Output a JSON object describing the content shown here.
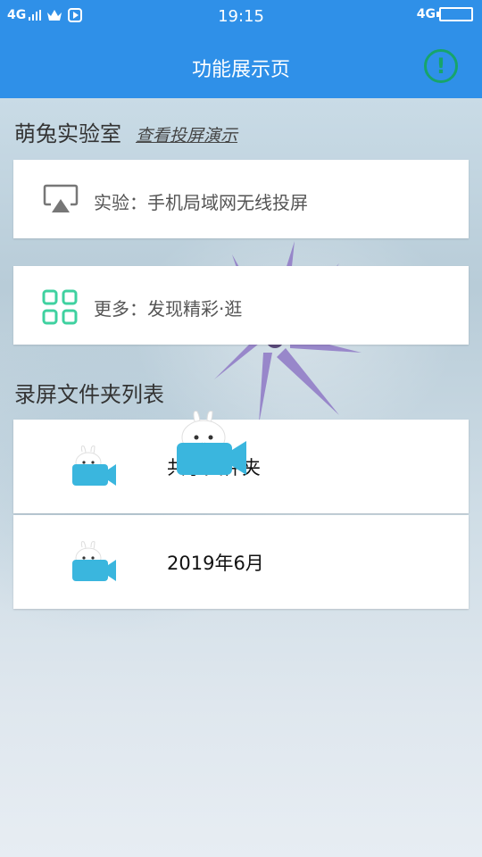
{
  "status_bar": {
    "network_left": "4G",
    "time": "19:15",
    "network_right": "4G"
  },
  "app_bar": {
    "title": "功能展示页",
    "info_icon": "info-icon",
    "info_symbol": "!"
  },
  "lab": {
    "title": "萌兔实验室",
    "demo_link": "查看投屏演示"
  },
  "cards": [
    {
      "icon": "airplay-icon",
      "label": "实验：手机局域网无线投屏"
    },
    {
      "icon": "grid-apps-icon",
      "label": "更多：发现精彩·逛"
    }
  ],
  "folders": {
    "title": "录屏文件夹列表",
    "items": [
      {
        "icon": "bunny-camera-icon",
        "name": "共享文件夹"
      },
      {
        "icon": "bunny-camera-icon",
        "name": "2019年6月"
      }
    ]
  },
  "colors": {
    "primary": "#2f90e8",
    "info_green": "#17a46b",
    "grid_icon": "#3fd1a0",
    "camera_blue": "#3ab6de"
  }
}
